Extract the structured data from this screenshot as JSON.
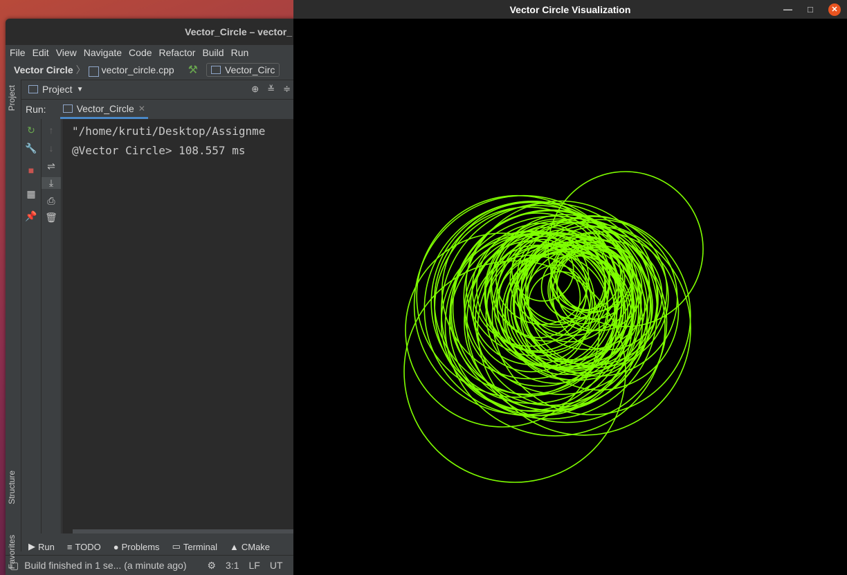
{
  "ide": {
    "title": "Vector_Circle – vector_",
    "menu": [
      "File",
      "Edit",
      "View",
      "Navigate",
      "Code",
      "Refactor",
      "Build",
      "Run"
    ],
    "breadcrumb_project": "Vector Circle",
    "breadcrumb_file": "vector_circle.cpp",
    "run_config": "Vector_Circ",
    "project_label": "Project",
    "left_tabs": [
      "Project",
      "Structure",
      "Favorites"
    ],
    "run_label": "Run:",
    "run_tab": "Vector_Circle",
    "console_lines": [
      "\"/home/kruti/Desktop/Assignme",
      "@Vector Circle> 108.557 ms"
    ],
    "bottom_tabs": [
      "Run",
      "TODO",
      "Problems",
      "Terminal",
      "CMake"
    ],
    "status_text": "Build finished in 1 se... (a minute ago)",
    "status_position": "3:1",
    "status_line_ending": "LF",
    "status_encoding": "UT"
  },
  "viz": {
    "title": "Vector Circle Visualization",
    "circle_color": "#7fff00"
  }
}
